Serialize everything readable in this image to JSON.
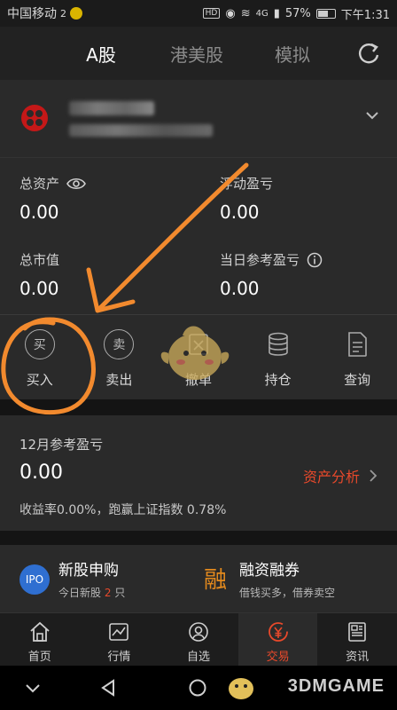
{
  "status_bar": {
    "carrier": "中国移动",
    "carrier_suffix": "2",
    "signal_text": "4G",
    "battery": "57%",
    "time": "下午1:31"
  },
  "top_tabs": [
    {
      "label": "A股"
    },
    {
      "label": "港美股"
    },
    {
      "label": "模拟"
    }
  ],
  "stats": {
    "total_assets_label": "总资产",
    "total_assets_value": "0.00",
    "float_pnl_label": "浮动盈亏",
    "float_pnl_value": "0.00",
    "market_value_label": "总市值",
    "market_value_value": "0.00",
    "daily_pnl_label": "当日参考盈亏",
    "daily_pnl_value": "0.00"
  },
  "actions": [
    {
      "label": "买入",
      "icon_char": "买",
      "icon": "buy-icon"
    },
    {
      "label": "卖出",
      "icon_char": "卖",
      "icon": "sell-icon"
    },
    {
      "label": "撤单",
      "icon": "cancel-order-icon"
    },
    {
      "label": "持仓",
      "icon": "holdings-icon"
    },
    {
      "label": "查询",
      "icon": "query-icon"
    }
  ],
  "monthly": {
    "title": "12月参考盈亏",
    "value": "0.00",
    "link_label": "资产分析",
    "summary": "收益率0.00%，跑赢上证指数 0.78%"
  },
  "promo": {
    "ipo_badge": "IPO",
    "ipo_title": "新股申购",
    "ipo_sub_prefix": "今日新股",
    "ipo_count": "2",
    "ipo_sub_suffix": "只",
    "margin_badge": "融",
    "margin_title": "融资融券",
    "margin_sub": "借钱买多，借券卖空"
  },
  "bottom_nav": [
    {
      "label": "首页",
      "icon": "home-icon"
    },
    {
      "label": "行情",
      "icon": "market-chart-icon"
    },
    {
      "label": "自选",
      "icon": "watchlist-icon"
    },
    {
      "label": "交易",
      "icon": "trade-yen-icon"
    },
    {
      "label": "资讯",
      "icon": "news-icon"
    }
  ],
  "watermark": "3DMGAME",
  "colors": {
    "accent": "#e8492b",
    "annotation": "#f28a2e",
    "ipo_blue": "#2f6fd1",
    "margin_orange": "#e48a1d"
  }
}
